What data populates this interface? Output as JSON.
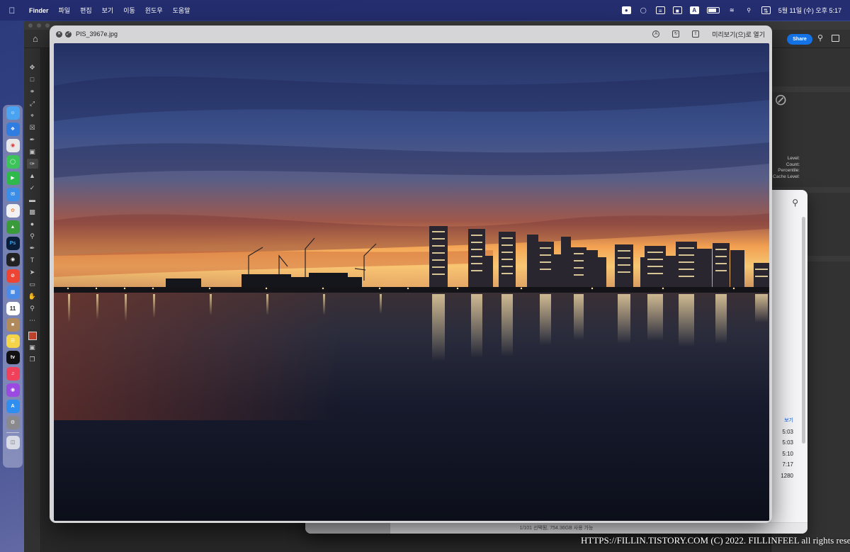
{
  "menubar": {
    "app_name": "Finder",
    "menus": [
      "파일",
      "편집",
      "보기",
      "이동",
      "윈도우",
      "도움말"
    ],
    "clock": "5월 11일 (수) 오후 5:17",
    "input_source": "A"
  },
  "photoshop": {
    "share_label": "Share",
    "histogram_labels": [
      "Level:",
      "Count:",
      "Percentile:",
      "Cache Level:"
    ]
  },
  "finder": {
    "list_header": "보기",
    "list_items": [
      "5:03",
      "5:03",
      "5:10",
      "7:17",
      "1280"
    ],
    "status_text": "1/101 선택됨, 754.36GB 사용 가능"
  },
  "preview": {
    "filename": "PIS_3967e.jpg",
    "open_button": "미리보기(으)로 열기"
  },
  "dock": {
    "calendar_day": "11",
    "ps_label": "Ps",
    "tv_label": "tv"
  },
  "watermark": "HTTPS://FILLIN.TISTORY.COM (C) 2022. FILLINFEEL all rights reserved."
}
